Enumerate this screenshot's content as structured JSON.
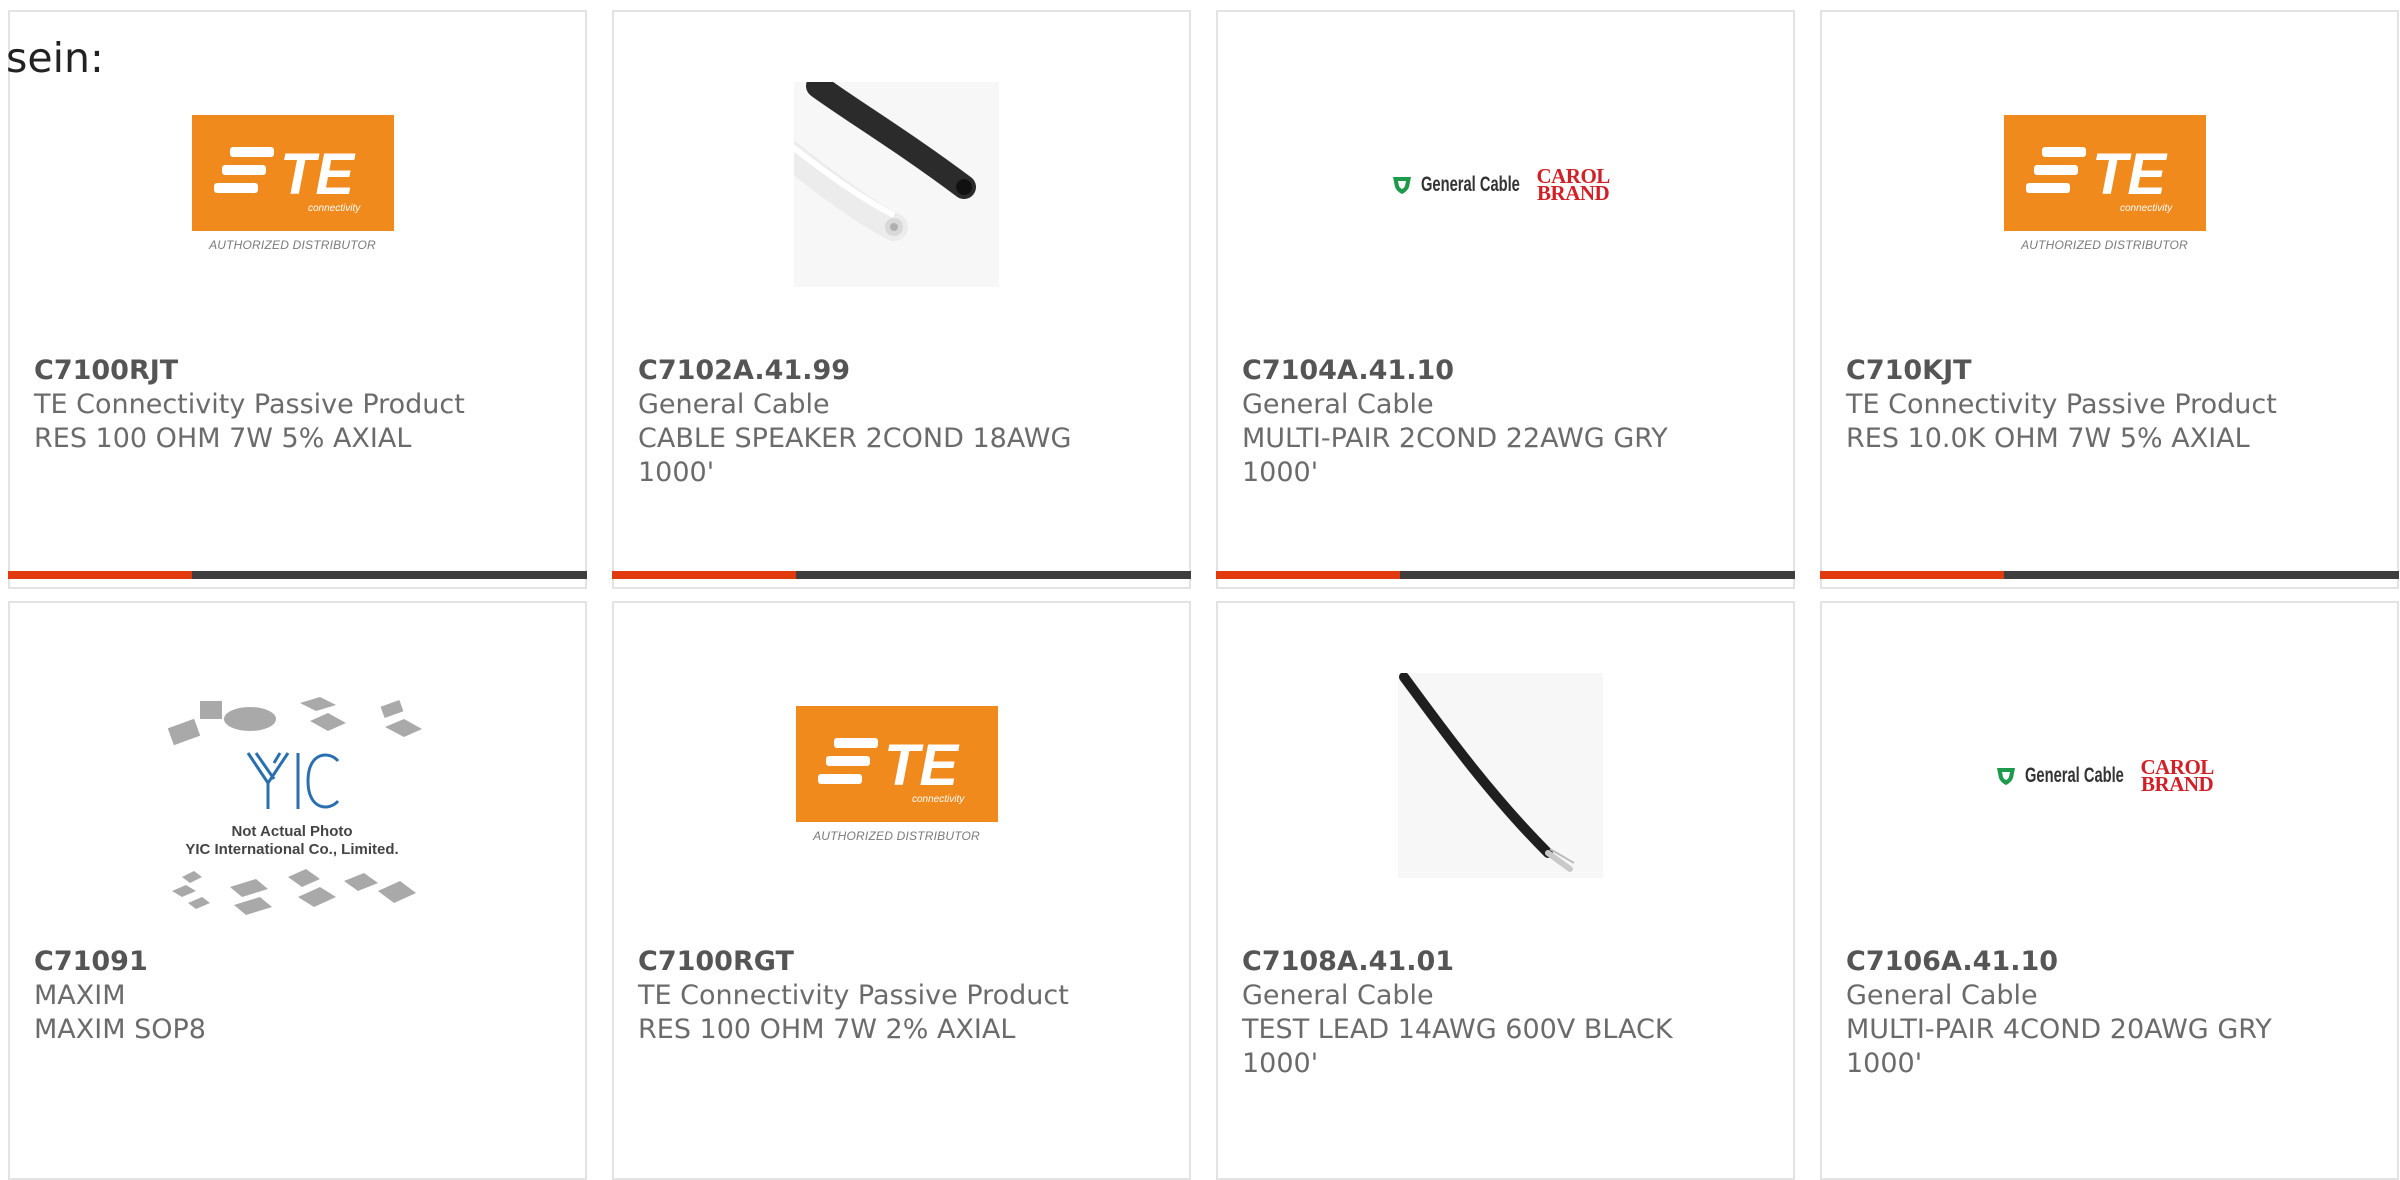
{
  "intro_text": "sein:",
  "colors": {
    "accent": "#e03a0e",
    "bar_dark": "#3e3e3e",
    "te_orange": "#f08a1c",
    "carol_red": "#d12027",
    "general_cable_green": "#1e9a4c"
  },
  "products": [
    {
      "part": "C7100RJT",
      "brand": "TE Connectivity Passive Product",
      "description": "RES 100 OHM 7W 5% AXIAL",
      "image": "te-logo",
      "logo_text": {
        "te": "TE",
        "connectivity": "connectivity",
        "caption": "AUTHORIZED DISTRIBUTOR"
      }
    },
    {
      "part": "C7102A.41.99",
      "brand": "General Cable",
      "description": "CABLE SPEAKER 2COND 18AWG 1000'",
      "image": "cable-photo-black-white"
    },
    {
      "part": "C7104A.41.10",
      "brand": "General Cable",
      "description": "MULTI-PAIR 2COND 22AWG GRY 1000'",
      "image": "general-cable-logo",
      "logo_text": {
        "general_cable": "General Cable",
        "carol_1": "CAROL",
        "carol_2": "BRAND"
      }
    },
    {
      "part": "C710KJT",
      "brand": "TE Connectivity Passive Product",
      "description": "RES 10.0K OHM 7W 5% AXIAL",
      "image": "te-logo",
      "logo_text": {
        "te": "TE",
        "connectivity": "connectivity",
        "caption": "AUTHORIZED DISTRIBUTOR"
      }
    },
    {
      "part": "C71091",
      "brand": "MAXIM",
      "description": "MAXIM SOP8",
      "image": "yic-placeholder",
      "logo_text": {
        "line1": "Not Actual Photo",
        "line2": "YIC International Co., Limited."
      }
    },
    {
      "part": "C7100RGT",
      "brand": "TE Connectivity Passive Product",
      "description": "RES 100 OHM 7W 2% AXIAL",
      "image": "te-logo",
      "logo_text": {
        "te": "TE",
        "connectivity": "connectivity",
        "caption": "AUTHORIZED DISTRIBUTOR"
      }
    },
    {
      "part": "C7108A.41.01",
      "brand": "General Cable",
      "description": "TEST LEAD 14AWG 600V BLACK 1000'",
      "image": "cable-photo-black"
    },
    {
      "part": "C7106A.41.10",
      "brand": "General Cable",
      "description": "MULTI-PAIR 4COND 20AWG GRY 1000'",
      "image": "general-cable-logo",
      "logo_text": {
        "general_cable": "General Cable",
        "carol_1": "CAROL",
        "carol_2": "BRAND"
      }
    }
  ]
}
